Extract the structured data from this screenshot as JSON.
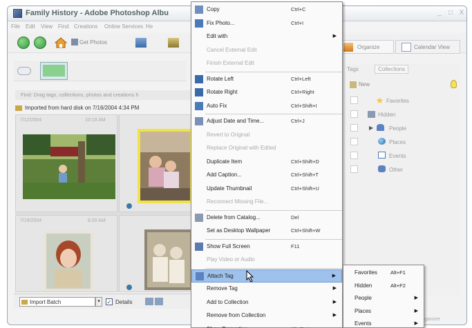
{
  "window": {
    "title": "Family History - Adobe Photoshop Albu",
    "controls": [
      "_",
      "□",
      "X"
    ]
  },
  "menubar": [
    "File",
    "Edit",
    "View",
    "Find",
    "Creations",
    "Online Services",
    "He"
  ],
  "toolbar": {
    "get_photos_label": "Get Photos"
  },
  "view_tabs": {
    "organize": "Organize",
    "calendar": "Calendar View"
  },
  "find_bar": "Find: Drag tags, collections, photos and creations h",
  "imported_label": "Imported from hard disk on 7/16/2004 4:34 PM",
  "photos": [
    {
      "date": "7/12/2004",
      "time": "10:18 AM"
    },
    {
      "date": "",
      "time": ""
    },
    {
      "date": "7/19/2004",
      "time": "8:20 AM"
    },
    {
      "date": "",
      "time": ""
    }
  ],
  "bottombar": {
    "batch_select": "Import Batch",
    "details_checked": true,
    "details_label": "Details"
  },
  "right_panel": {
    "tabs": [
      "Tags",
      "Collections"
    ],
    "new_label": "New",
    "tags": [
      {
        "label": "Favorites",
        "icon": "star-icon"
      },
      {
        "label": "Hidden",
        "icon": "hidden-icon"
      },
      {
        "label": "People",
        "icon": "people-icon"
      },
      {
        "label": "Places",
        "icon": "globe-icon"
      },
      {
        "label": "Events",
        "icon": "calendar-icon"
      },
      {
        "label": "Other",
        "icon": "tag-icon"
      }
    ],
    "footer": "ganizer"
  },
  "context_menu": {
    "items": [
      {
        "label": "Copy",
        "shortcut": "Ctrl+C",
        "enabled": true,
        "icon": "copy-icon"
      },
      {
        "label": "Fix Photo...",
        "shortcut": "Ctrl+I",
        "enabled": true,
        "icon": "fix-photo-icon"
      },
      {
        "label": "Edit with",
        "shortcut": "",
        "enabled": true,
        "submenu": true
      },
      {
        "label": "Cancel External Edit",
        "shortcut": "",
        "enabled": false
      },
      {
        "label": "Finish External Edit",
        "shortcut": "",
        "enabled": false
      },
      {
        "label": "Rotate Left",
        "shortcut": "Ctrl+Left",
        "enabled": true,
        "icon": "rotate-left-icon"
      },
      {
        "label": "Rotate Right",
        "shortcut": "Ctrl+Right",
        "enabled": true,
        "icon": "rotate-right-icon"
      },
      {
        "label": "Auto Fix",
        "shortcut": "Ctrl+Shift+I",
        "enabled": true,
        "icon": "auto-fix-icon"
      },
      {
        "label": "Adjust Date and Time...",
        "shortcut": "Ctrl+J",
        "enabled": true,
        "icon": "clock-icon"
      },
      {
        "label": "Revert to Original",
        "shortcut": "",
        "enabled": false
      },
      {
        "label": "Replace Original with Edited",
        "shortcut": "",
        "enabled": false
      },
      {
        "label": "Duplicate Item",
        "shortcut": "Ctrl+Shift+D",
        "enabled": true
      },
      {
        "label": "Add Caption...",
        "shortcut": "Ctrl+Shift+T",
        "enabled": true
      },
      {
        "label": "Update Thumbnail",
        "shortcut": "Ctrl+Shift+U",
        "enabled": true
      },
      {
        "label": "Reconnect Missing File...",
        "shortcut": "",
        "enabled": false
      },
      {
        "label": "Delete from Catalog...",
        "shortcut": "Del",
        "enabled": true,
        "icon": "trash-icon"
      },
      {
        "label": "Set as Desktop Wallpaper",
        "shortcut": "Ctrl+Shift+W",
        "enabled": true
      },
      {
        "label": "Show Full Screen",
        "shortcut": "F11",
        "enabled": true,
        "icon": "fullscreen-icon"
      },
      {
        "label": "Play Video or Audio",
        "shortcut": "",
        "enabled": false
      },
      {
        "label": "Attach Tag",
        "shortcut": "",
        "enabled": true,
        "submenu": true,
        "highlighted": true,
        "icon": "tag-icon"
      },
      {
        "label": "Remove Tag",
        "shortcut": "",
        "enabled": true,
        "submenu": true
      },
      {
        "label": "Add to Collection",
        "shortcut": "",
        "enabled": true,
        "submenu": true
      },
      {
        "label": "Remove from Collection",
        "shortcut": "",
        "enabled": true,
        "submenu": true
      },
      {
        "label": "Show Properties",
        "shortcut": "Alt+Enter",
        "enabled": true
      }
    ]
  },
  "submenu": {
    "items": [
      {
        "label": "Favorites",
        "shortcut": "Alt+F1"
      },
      {
        "label": "Hidden",
        "shortcut": "Alt+F2"
      },
      {
        "label": "People",
        "shortcut": "",
        "submenu": true
      },
      {
        "label": "Places",
        "shortcut": "",
        "submenu": true
      },
      {
        "label": "Events",
        "shortcut": "",
        "submenu": true
      }
    ]
  },
  "colors": {
    "highlight": "#9fc2ec",
    "window_border": "#9aa6b8",
    "selected_photo_border": "#f0e24a"
  }
}
